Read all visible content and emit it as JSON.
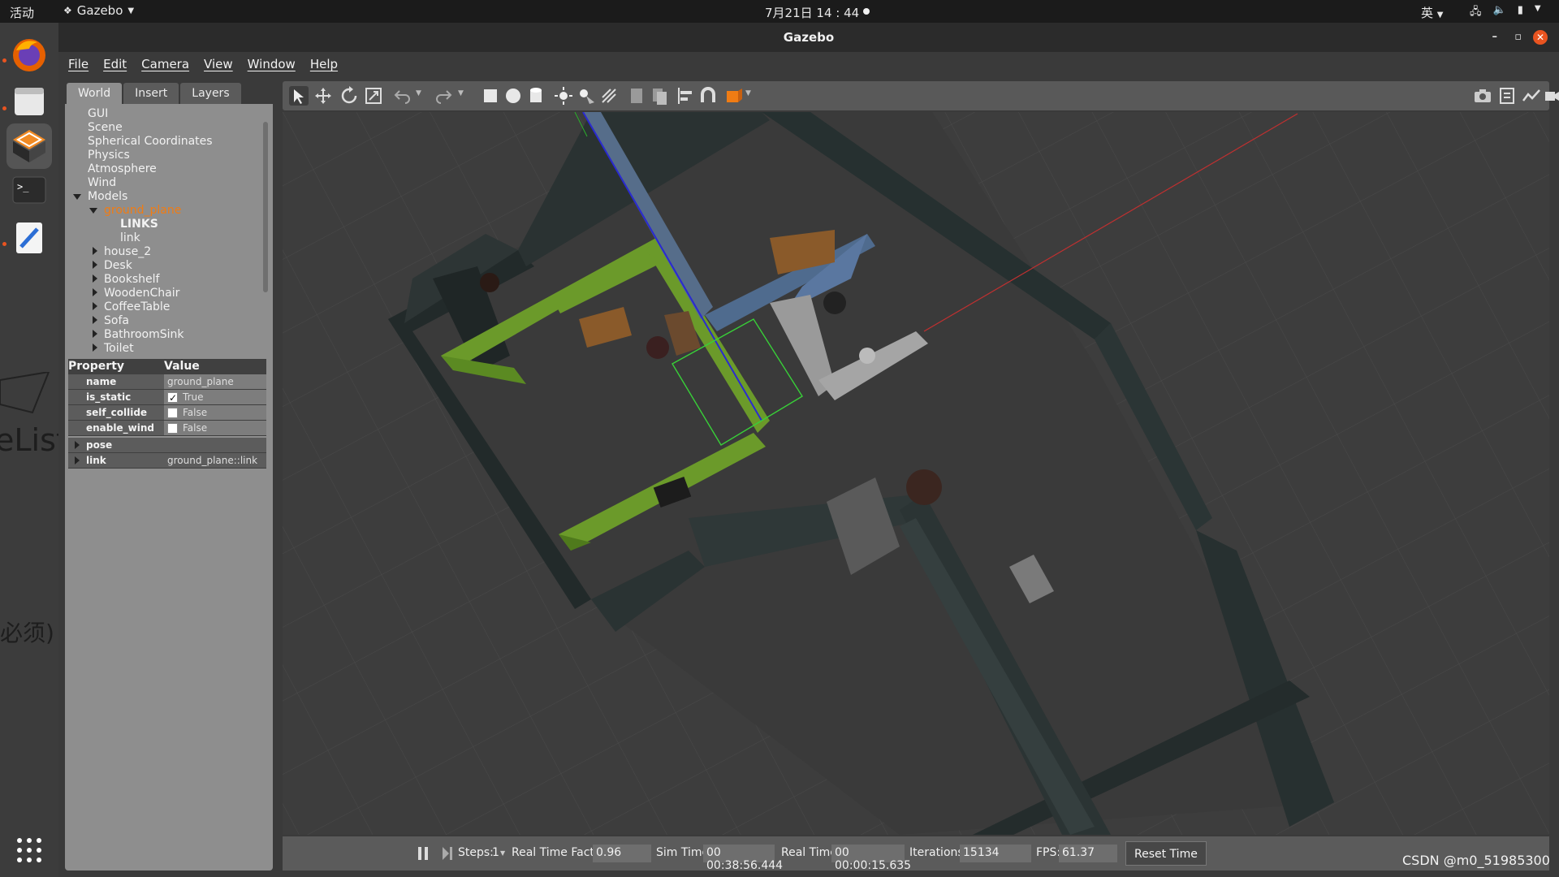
{
  "topbar": {
    "activities": "活动",
    "app_name": "Gazebo",
    "clock": "7月21日 14 : 44",
    "ime": "英"
  },
  "window": {
    "title": "Gazebo"
  },
  "menu": [
    "File",
    "Edit",
    "Camera",
    "View",
    "Window",
    "Help"
  ],
  "tabs": [
    "World",
    "Insert",
    "Layers"
  ],
  "tree": {
    "items": [
      "GUI",
      "Scene",
      "Spherical Coordinates",
      "Physics",
      "Atmosphere",
      "Wind"
    ],
    "models_label": "Models",
    "ground_plane": "ground_plane",
    "links_label": "LINKS",
    "link_label": "link",
    "models": [
      "house_2",
      "Desk",
      "Bookshelf",
      "WoodenChair",
      "CoffeeTable",
      "Sofa",
      "BathroomSink",
      "Toilet"
    ]
  },
  "props": {
    "header_property": "Property",
    "header_value": "Value",
    "rows": [
      {
        "key": "name",
        "value": "ground_plane"
      },
      {
        "key": "is_static",
        "value": "True",
        "checked": true
      },
      {
        "key": "self_collide",
        "value": "False",
        "checked": false
      },
      {
        "key": "enable_wind",
        "value": "False",
        "checked": false
      },
      {
        "key": "pose",
        "value": ""
      },
      {
        "key": "link",
        "value": "ground_plane::link"
      }
    ]
  },
  "bottom": {
    "steps_label": "Steps:",
    "steps_value": "1",
    "rtf_label": "Real Time Factor:",
    "rtf_value": "0.96",
    "sim_label": "Sim Time:",
    "sim_value": "00 00:38:56.444",
    "real_label": "Real Time:",
    "real_value": "00 00:00:15.635",
    "iter_label": "Iterations:",
    "iter_value": "15134",
    "fps_label": "FPS:",
    "fps_value": "61.37",
    "reset_label": "Reset Time"
  },
  "watermark": "CSDN @m0_51985300",
  "dock_ghost": [
    "eLists",
    "必须)"
  ]
}
